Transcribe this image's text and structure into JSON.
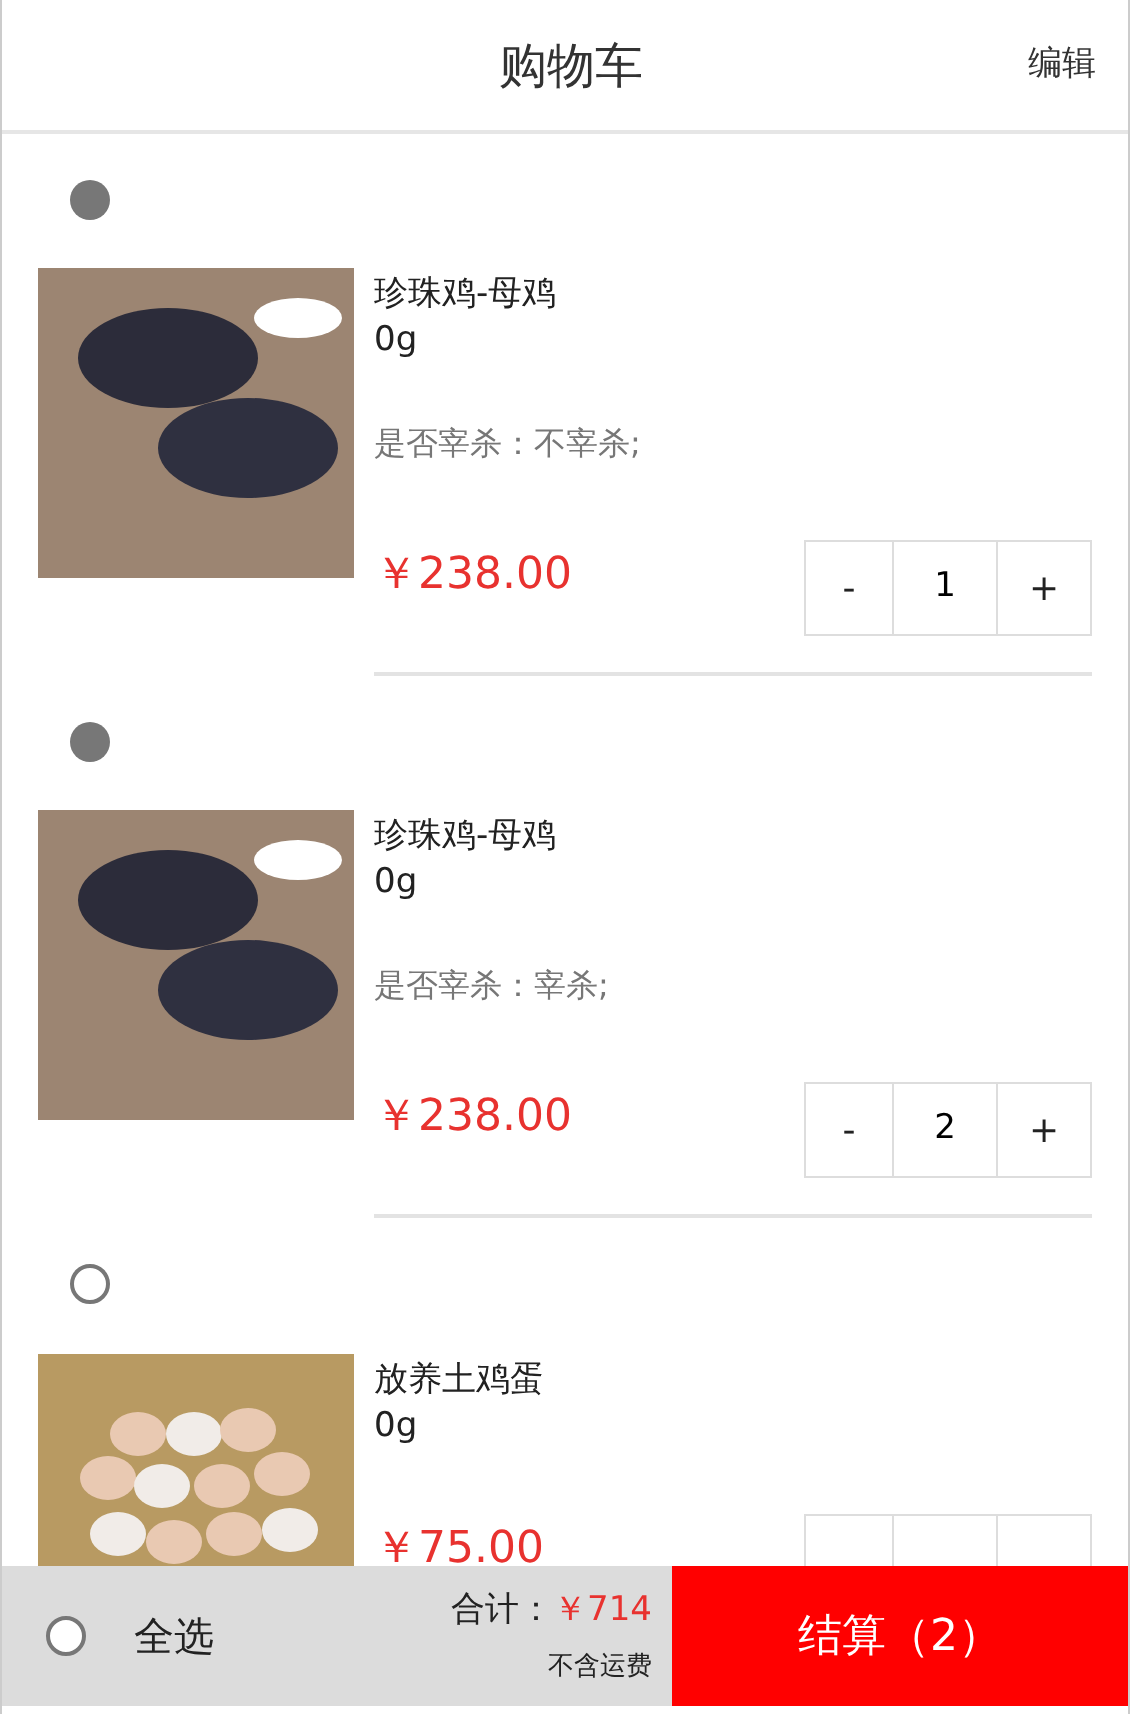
{
  "header": {
    "title": "购物车",
    "action": "编辑"
  },
  "stepper": {
    "minus": "-",
    "plus": "+"
  },
  "items": [
    {
      "selected": true,
      "name": "珍珠鸡-母鸡",
      "weight": "0g",
      "attribute": "是否宰杀：不宰杀;",
      "price": "￥238.00",
      "quantity": "1",
      "kind": "bird"
    },
    {
      "selected": true,
      "name": "珍珠鸡-母鸡",
      "weight": "0g",
      "attribute": "是否宰杀：宰杀;",
      "price": "￥238.00",
      "quantity": "2",
      "kind": "bird"
    },
    {
      "selected": false,
      "name": "放养土鸡蛋",
      "weight": "0g",
      "price": "￥75.00",
      "kind": "eggs"
    }
  ],
  "footer": {
    "select_all": {
      "label": "全选",
      "selected": false
    },
    "total_label": "合计：",
    "total": "￥714",
    "shipping_note": "不含运费",
    "checkout": "结算（2）"
  }
}
